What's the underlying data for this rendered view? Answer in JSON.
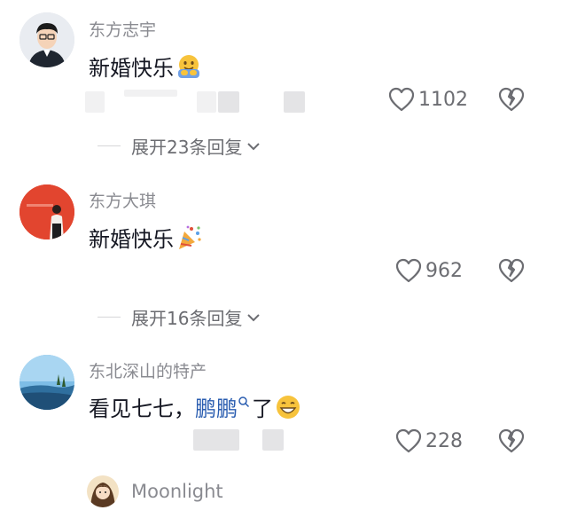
{
  "comments": [
    {
      "username": "东方志宇",
      "text": "新婚快乐",
      "emoji": "hugging-face-emoji",
      "likes": "1102",
      "expand_label": "展开23条回复"
    },
    {
      "username": "东方大琪",
      "text": "新婚快乐",
      "emoji": "party-popper-emoji",
      "likes": "962",
      "expand_label": "展开16条回复"
    },
    {
      "username": "东北深山的特产",
      "text_prefix": "看见七七，",
      "mention": "鹏鹏",
      "text_suffix": "了",
      "emoji": "grinning-face-emoji",
      "likes": "228"
    }
  ],
  "reply": {
    "username": "Moonlight"
  },
  "colors": {
    "text": "#161823",
    "secondary": "#8a8b91",
    "mention": "#2a5db0",
    "avatar2_bg": "#e2452f"
  }
}
